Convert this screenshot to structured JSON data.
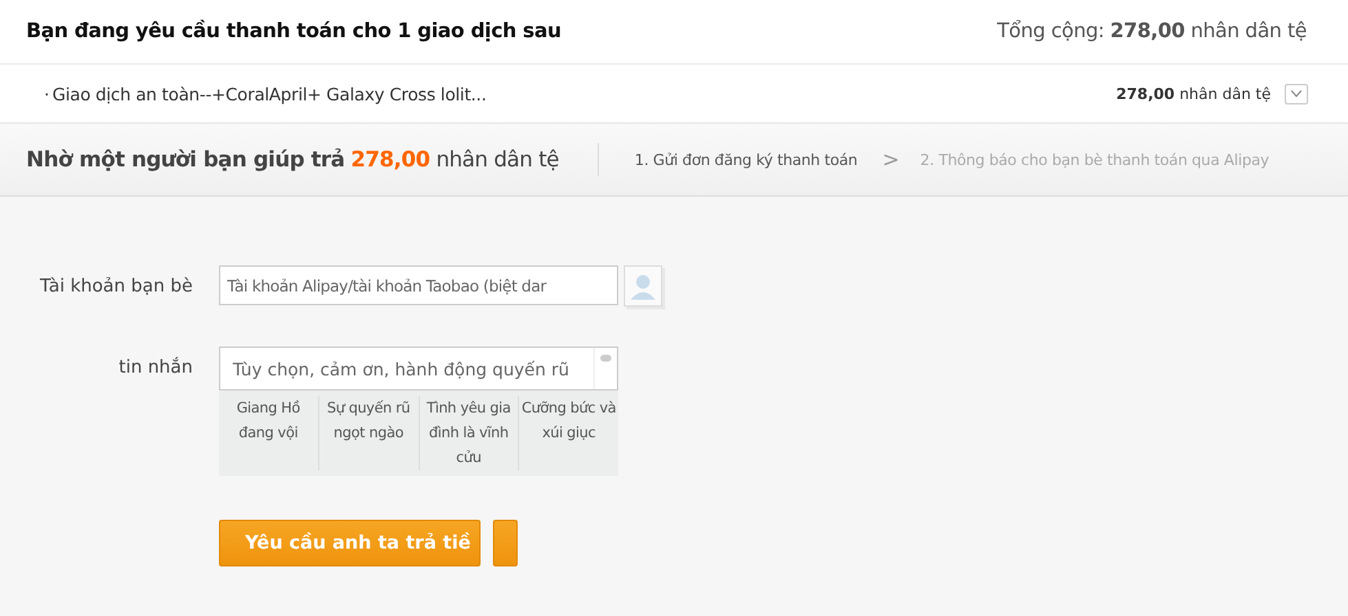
{
  "header": {
    "title": "Bạn đang yêu cầu thanh toán cho 1 giao dịch sau",
    "total_label": "Tổng cộng:",
    "total_amount": "278,00",
    "total_currency": "nhân dân tệ"
  },
  "order": {
    "bullet": "·",
    "name": "Giao dịch an toàn--+CoralApril+ Galaxy Cross lolit...",
    "amount": "278,00",
    "currency": "nhân dân tệ",
    "expanded": false
  },
  "section": {
    "title": "Nhờ một người bạn giúp trả",
    "amount": "278,00",
    "currency": "nhân dân tệ",
    "steps": [
      {
        "label": "1. Gửi đơn đăng ký thanh toán",
        "selected": true
      },
      {
        "label": "2. Thông báo cho bạn bè thanh toán qua Alipay",
        "selected": false
      }
    ],
    "separator": ">"
  },
  "form": {
    "account_label": "Tài khoản bạn bè",
    "account_placeholder": "Tài khoản Alipay/tài khoản Taobao (biệt dar",
    "message_label": "tin nhắn",
    "message_placeholder": "Tùy chọn, cảm ơn, hành động quyến rũ",
    "suggestions": [
      "Giang Hồ đang vội",
      "Sự quyến rũ ngọt ngào",
      "Tình yêu gia đình là vĩnh cửu",
      "Cưỡng bức và xúi giục"
    ],
    "submit": "Yêu cầu anh ta trả tiề"
  }
}
